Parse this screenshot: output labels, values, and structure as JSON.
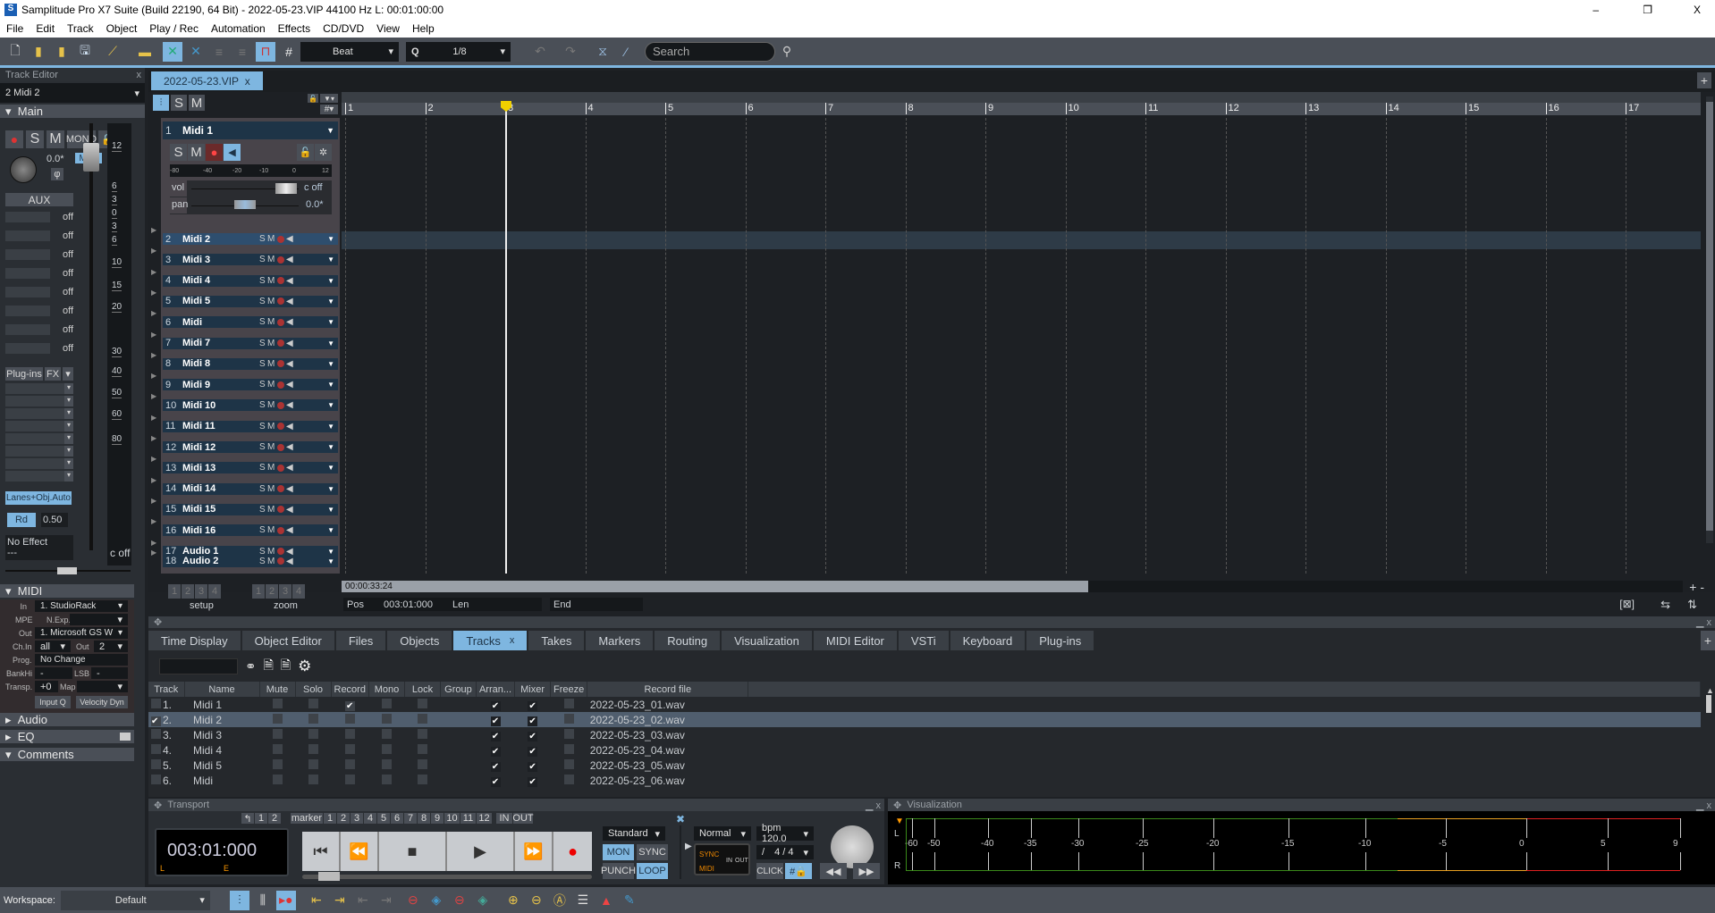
{
  "window": {
    "title": "Samplitude Pro X7 Suite (Build 22190, 64 Bit)  -  2022-05-23.VIP   44100 Hz L: 00:01:00:00",
    "min": "–",
    "max": "❐",
    "close": "X"
  },
  "menu": [
    "File",
    "Edit",
    "Track",
    "Object",
    "Play / Rec",
    "Automation",
    "Effects",
    "CD/DVD",
    "View",
    "Help"
  ],
  "toolbar": {
    "grid_mode": "Beat",
    "quantize_label": "Q",
    "quantize": "1/8",
    "search_placeholder": "Search"
  },
  "track_editor": {
    "title": "Track Editor",
    "selected_track": "2  Midi 2",
    "main": "Main",
    "buttons": {
      "s": "S",
      "m": "M",
      "mono": "MONO",
      "midi": "MIDI",
      "phase": "φ",
      "aux": "AUX",
      "plugins": "Plug-ins",
      "fx": "FX",
      "lanes": "Lanes+Obj.Auto",
      "rd": "Rd",
      "rd_value": "0.50",
      "no_effect": "No Effect",
      "dashes": "---",
      "coff": "c off"
    },
    "pan_value": "0.0*",
    "aux_sends": [
      "off",
      "off",
      "off",
      "off",
      "off",
      "off",
      "off",
      "off"
    ],
    "fader_scale": [
      "12",
      "6",
      "3",
      "0",
      "3",
      "6",
      "10",
      "15",
      "20",
      "30",
      "40",
      "50",
      "60",
      "80"
    ],
    "midi": {
      "title": "MIDI",
      "in_label": "In",
      "in": "1. StudioRack",
      "mpe": "MPE",
      "nexp": "N.Exp.",
      "out_label": "Out",
      "out": "1. Microsoft GS W",
      "chin_label": "Ch.In",
      "chin": "all",
      "out2_label": "Out",
      "out2": "2",
      "prog_label": "Prog.",
      "prog": "No Change",
      "bankhi": "BankHi",
      "bankhi_v": "-",
      "lsb": "LSB",
      "lsb_v": "-",
      "transp": "Transp.",
      "transp_v": "+0",
      "map": "Map",
      "inputq": "Input Q",
      "veldyn": "Velocity Dyn"
    },
    "sections": {
      "audio": "Audio",
      "eq": "EQ",
      "comments": "Comments"
    }
  },
  "project": {
    "tab": "2022-05-23.VIP",
    "s": "S",
    "m": "M",
    "track1": {
      "num": "1",
      "name": "Midi 1",
      "meter": [
        "-80",
        "-40",
        "-20",
        "-10",
        "0",
        "12"
      ],
      "vol": "vol",
      "vol_value": "c off",
      "pan": "pan",
      "pan_value": "0.0*"
    },
    "tracks": [
      {
        "num": "2",
        "name": "Midi 2",
        "selected": true
      },
      {
        "num": "3",
        "name": "Midi 3"
      },
      {
        "num": "4",
        "name": "Midi 4"
      },
      {
        "num": "5",
        "name": "Midi 5"
      },
      {
        "num": "6",
        "name": "Midi"
      },
      {
        "num": "7",
        "name": "Midi 7"
      },
      {
        "num": "8",
        "name": "Midi 8"
      },
      {
        "num": "9",
        "name": "Midi 9"
      },
      {
        "num": "10",
        "name": "Midi 10"
      },
      {
        "num": "11",
        "name": "Midi 11"
      },
      {
        "num": "12",
        "name": "Midi 12"
      },
      {
        "num": "13",
        "name": "Midi 13"
      },
      {
        "num": "14",
        "name": "Midi 14"
      },
      {
        "num": "15",
        "name": "Midi 15"
      },
      {
        "num": "16",
        "name": "Midi 16"
      },
      {
        "num": "17",
        "name": "Audio 1"
      },
      {
        "num": "18",
        "name": "Audio 2"
      }
    ],
    "ruler": [
      "1",
      "2",
      "3",
      "4",
      "5",
      "6",
      "7",
      "8",
      "9",
      "10",
      "11",
      "12",
      "13",
      "14",
      "15",
      "16",
      "17"
    ],
    "playhead_bar": 3,
    "scroll_time": "00:00:33:24",
    "setup": [
      "1",
      "2",
      "3",
      "4"
    ],
    "setup_label": "setup",
    "zoom": [
      "1",
      "2",
      "3",
      "4"
    ],
    "zoom_label": "zoom",
    "pos_label": "Pos",
    "pos": "003:01:000",
    "len_label": "Len",
    "end_label": "End"
  },
  "dock": {
    "tabs": [
      "Time Display",
      "Object Editor",
      "Files",
      "Objects",
      "Tracks",
      "Takes",
      "Markers",
      "Routing",
      "Visualization",
      "MIDI Editor",
      "VSTi",
      "Keyboard",
      "Plug-ins"
    ],
    "active_tab": "Tracks",
    "columns": [
      "Track",
      "Name",
      "Mute",
      "Solo",
      "Record",
      "Mono",
      "Lock",
      "Group",
      "Arran...",
      "Mixer",
      "Freeze",
      "Record file"
    ],
    "rows": [
      {
        "track": "1.",
        "name": "Midi 1",
        "record": true,
        "file": "2022-05-23_01.wav"
      },
      {
        "track": "2.",
        "name": "Midi 2",
        "checked": true,
        "selected": true,
        "file": "2022-05-23_02.wav"
      },
      {
        "track": "3.",
        "name": "Midi 3",
        "file": "2022-05-23_03.wav"
      },
      {
        "track": "4.",
        "name": "Midi 4",
        "file": "2022-05-23_04.wav"
      },
      {
        "track": "5.",
        "name": "Midi 5",
        "file": "2022-05-23_05.wav"
      },
      {
        "track": "6.",
        "name": "Midi",
        "file": "2022-05-23_06.wav"
      }
    ]
  },
  "transport": {
    "title": "Transport",
    "time": "003:01:000",
    "l": "L",
    "e": "E",
    "marker": "marker",
    "marker_nums": [
      "1",
      "2",
      "3",
      "4",
      "5",
      "6",
      "7",
      "8",
      "9",
      "10",
      "11",
      "12"
    ],
    "in": "IN",
    "out": "OUT",
    "back_nums": [
      "1",
      "2"
    ],
    "mode": "Standard",
    "mon": "MON",
    "sync": "SYNC",
    "punch": "PUNCH",
    "loop": "LOOP",
    "play_mode": "Normal",
    "bpm": "bpm  120.0",
    "sig_sep": "/",
    "sig": "4 / 4",
    "sync_led": "SYNC",
    "midi_led": "MIDI",
    "in_led": "IN",
    "out_led": "OUT",
    "click": "CLICK"
  },
  "visualization": {
    "title": "Visualization",
    "l": "L",
    "r": "R",
    "scale": [
      "-60",
      "-50",
      "-40",
      "-35",
      "-30",
      "-25",
      "-20",
      "-15",
      "-10",
      "-5",
      "0",
      "5",
      "9"
    ]
  },
  "workspace": {
    "label": "Workspace:",
    "value": "Default"
  }
}
